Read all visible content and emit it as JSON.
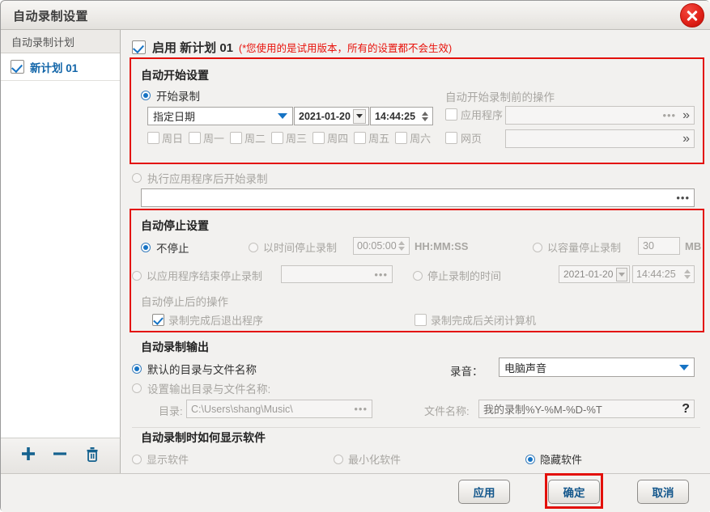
{
  "window": {
    "title": "自动录制设置",
    "close_icon": "close-icon"
  },
  "sidebar": {
    "header": "自动录制计划",
    "items": [
      {
        "label": "新计划 01",
        "checked": true
      }
    ],
    "toolbar": {
      "add": "+",
      "remove": "−",
      "delete": "trash-icon"
    }
  },
  "enable": {
    "label": "启用 新计划 01",
    "trial_note": "(*您使用的是试用版本，所有的设置都不会生效)"
  },
  "start_section": {
    "title": "自动开始设置",
    "radio_start_record": "开始录制",
    "date_mode": "指定日期",
    "date": "2021-01-20",
    "time": "14:44:25",
    "weekdays": [
      "周日",
      "周一",
      "周二",
      "周三",
      "周四",
      "周五",
      "周六"
    ],
    "pre_actions_title": "自动开始录制前的操作",
    "app_label": "应用程序",
    "app_value": "",
    "web_label": "网页",
    "web_value": "",
    "radio_after_app": "执行应用程序后开始录制",
    "after_app_value": ""
  },
  "stop_section": {
    "title": "自动停止设置",
    "no_stop": "不停止",
    "stop_by_time": "以时间停止录制",
    "stop_time_value": "00:05:00",
    "time_format": "HH:MM:SS",
    "stop_by_size": "以容量停止录制",
    "size_value": "30",
    "size_unit": "MB",
    "stop_by_app_end": "以应用程序结束停止录制",
    "app_end_value": "",
    "stop_at_time": "停止录制的时间",
    "stop_date": "2021-01-20",
    "stop_clock": "14:44:25",
    "after_stop_title": "自动停止后的操作",
    "exit_program": "录制完成后退出程序",
    "shutdown_pc": "录制完成后关闭计算机"
  },
  "output_section": {
    "title": "自动录制输出",
    "default_dir": "默认的目录与文件名称",
    "custom_dir": "设置输出目录与文件名称:",
    "dir_label": "目录:",
    "dir_value": "C:\\Users\\shang\\Music\\",
    "filename_label": "文件名称:",
    "filename_value": "我的录制%Y-%M-%D-%T",
    "audio_label": "录音：",
    "audio_value": "电脑声音",
    "help": "?"
  },
  "display_section": {
    "title": "自动录制时如何显示软件",
    "show": "显示软件",
    "minimize": "最小化软件",
    "hide": "隐藏软件"
  },
  "buttons": {
    "apply": "应用",
    "ok": "确定",
    "cancel": "取消"
  }
}
